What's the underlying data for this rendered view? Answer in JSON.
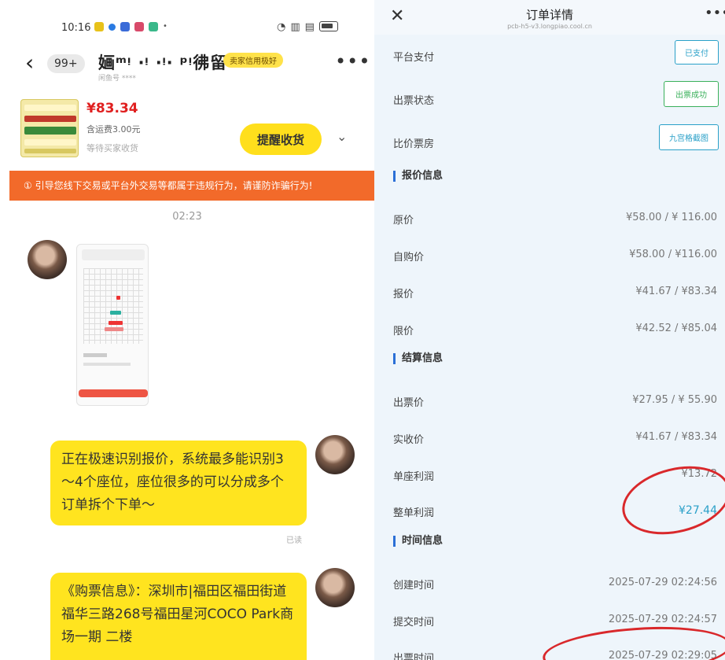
{
  "status_bar": {
    "time": "10:16",
    "icons": [
      "wifi-icon",
      "signal-icon",
      "battery-icon"
    ]
  },
  "chat_header": {
    "unread": "99+",
    "peer_name": "婳ᵐᵎ  ‧ᵎ  ‧ᵎ‧ ᵖᵎ彿留",
    "peer_sub": "闲鱼号 ****",
    "peer_tag": "卖家信用极好"
  },
  "product": {
    "price": "¥83.34",
    "shipping": "含运费3.00元",
    "seller_note": "等待买家收货",
    "remind_button": "提醒收货"
  },
  "warning": "① 引导您线下交易或平台外交易等都属于违规行为，请谨防诈骗行为!",
  "chat_time": "02:23",
  "messages": {
    "msg1": "正在极速识别报价，系统最多能识别3～4个座位，座位很多的可以分成多个订单拆个下单～",
    "msg1_read": "已读",
    "msg2": "《购票信息》：深圳市|福田区福田街道福华三路268号福田星河COCO Park商场一期 二楼"
  },
  "detail": {
    "title": "订单详情",
    "url": "pcb-h5-v3.longpiao.cool.cn",
    "rows_top": [
      {
        "label": "平台支付",
        "value": "已支付",
        "color": "#2aa0c8"
      },
      {
        "label": "出票状态",
        "value": "出票成功",
        "color": "#3ab05a"
      },
      {
        "label": "比价票房",
        "value": "九宫格截图",
        "color": "#2aa0c8"
      }
    ],
    "sec_price": "报价信息",
    "price_rows": [
      {
        "label": "原价",
        "value": "¥58.00 / ¥ 116.00"
      },
      {
        "label": "自购价",
        "value": "¥58.00 / ¥116.00"
      },
      {
        "label": "报价",
        "value": "¥41.67 / ¥83.34"
      },
      {
        "label": "限价",
        "value": "¥42.52 / ¥85.04"
      }
    ],
    "sec_settle": "结算信息",
    "settle_rows": [
      {
        "label": "出票价",
        "value": "¥27.95 / ¥ 55.90"
      },
      {
        "label": "实收价",
        "value": "¥41.67 / ¥83.34"
      },
      {
        "label": "单座利润",
        "value": "¥13.72"
      },
      {
        "label": "整单利润",
        "value": "¥27.44"
      }
    ],
    "sec_time": "时间信息",
    "time_rows": [
      {
        "label": "创建时间",
        "value": "2025-07-29 02:24:56"
      },
      {
        "label": "提交时间",
        "value": "2025-07-29 02:24:57"
      },
      {
        "label": "出票时间",
        "value": "2025-07-29 02:29:05"
      }
    ]
  }
}
